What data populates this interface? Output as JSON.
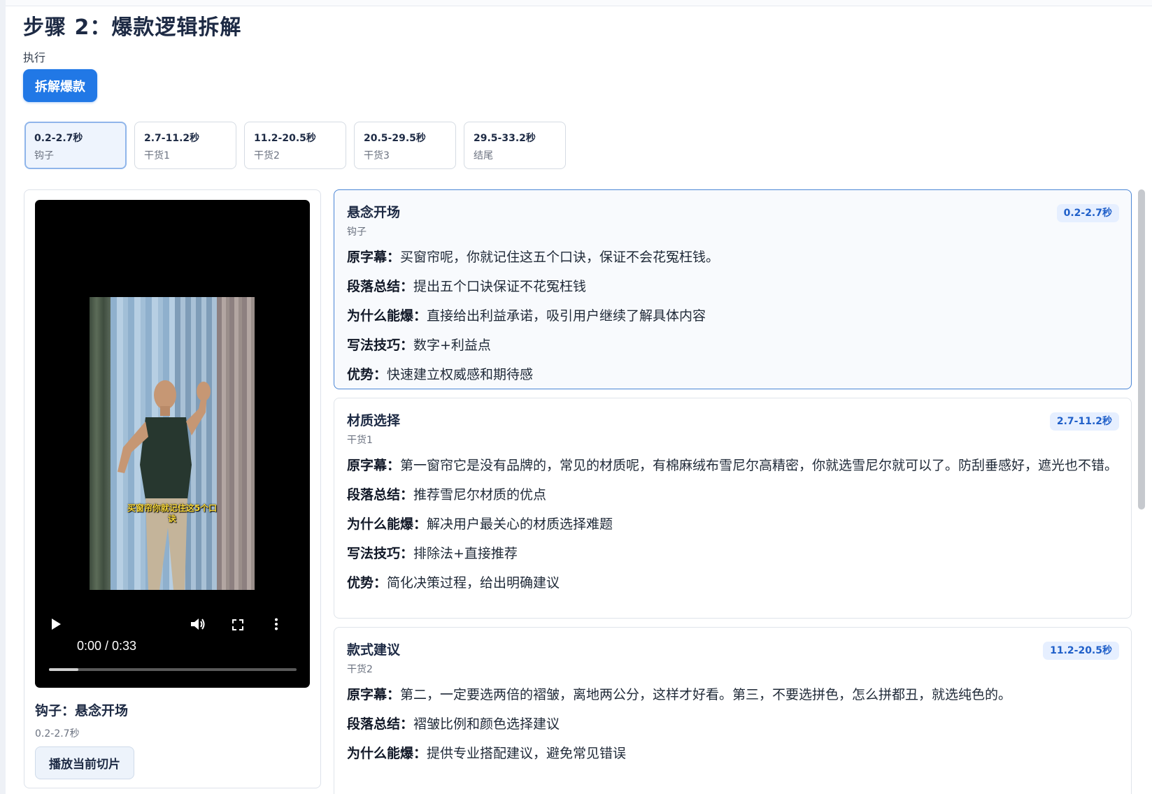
{
  "page": {
    "title": "步骤 2：爆款逻辑拆解",
    "exec_label": "执行",
    "analyze_button": "拆解爆款"
  },
  "segments": [
    {
      "time": "0.2-2.7秒",
      "role": "钩子",
      "active": true
    },
    {
      "time": "2.7-11.2秒",
      "role": "干货1",
      "active": false
    },
    {
      "time": "11.2-20.5秒",
      "role": "干货2",
      "active": false
    },
    {
      "time": "20.5-29.5秒",
      "role": "干货3",
      "active": false
    },
    {
      "time": "29.5-33.2秒",
      "role": "结尾",
      "active": false
    }
  ],
  "player": {
    "caption": "买窗帘你就记住这5个口诀",
    "time_display": "0:00 / 0:33",
    "buffered_fraction": 0.12,
    "clip_title": "钩子：悬念开场",
    "clip_time": "0.2-2.7秒",
    "play_clip_button": "播放当前切片",
    "icons": {
      "play": "play-icon",
      "volume": "volume-icon",
      "fullscreen": "fullscreen-icon",
      "more": "more-vertical-icon"
    }
  },
  "labels": {
    "original": "原字幕：",
    "summary": "段落总结：",
    "why": "为什么能爆：",
    "technique": "写法技巧：",
    "advantage": "优势："
  },
  "sections": [
    {
      "title": "悬念开场",
      "role": "钩子",
      "badge": "0.2-2.7秒",
      "original": "买窗帘呢，你就记住这五个口诀，保证不会花冤枉钱。",
      "summary": "提出五个口诀保证不花冤枉钱",
      "why": "直接给出利益承诺，吸引用户继续了解具体内容",
      "technique": "数字+利益点",
      "advantage": "快速建立权威感和期待感"
    },
    {
      "title": "材质选择",
      "role": "干货1",
      "badge": "2.7-11.2秒",
      "original": "第一窗帘它是没有品牌的，常见的材质呢，有棉麻绒布雪尼尔高精密，你就选雪尼尔就可以了。防刮垂感好，遮光也不错。",
      "summary": "推荐雪尼尔材质的优点",
      "why": "解决用户最关心的材质选择难题",
      "technique": "排除法+直接推荐",
      "advantage": "简化决策过程，给出明确建议"
    },
    {
      "title": "款式建议",
      "role": "干货2",
      "badge": "11.2-20.5秒",
      "original": "第二，一定要选两倍的褶皱，离地两公分，这样才好看。第三，不要选拼色，怎么拼都丑，就选纯色的。",
      "summary": "褶皱比例和颜色选择建议",
      "why": "提供专业搭配建议，避免常见错误"
    }
  ]
}
